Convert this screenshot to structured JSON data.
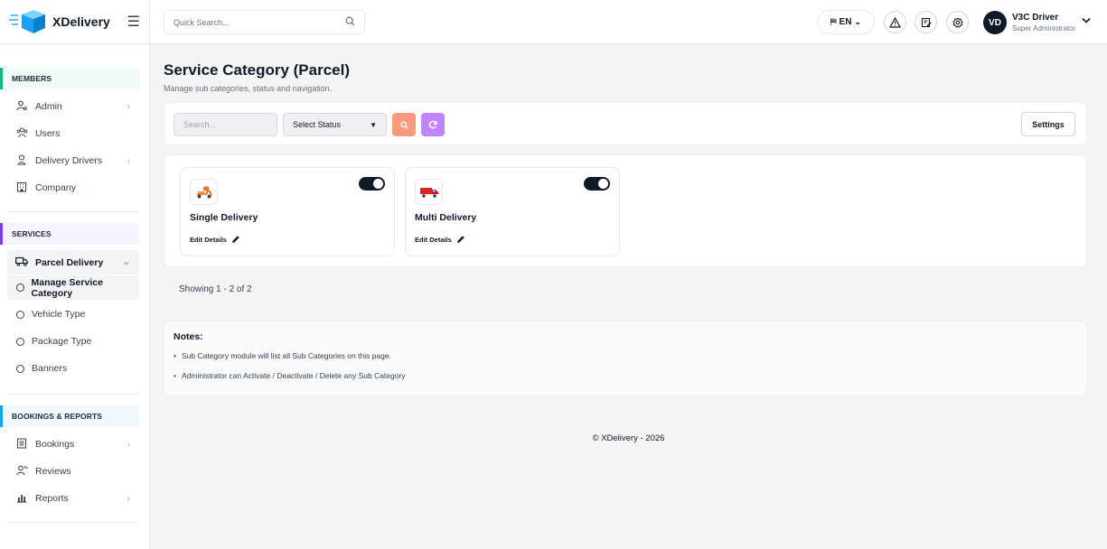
{
  "brand": {
    "name": "XDelivery"
  },
  "topbar": {
    "search_placeholder": "Quick Search...",
    "language": "EN",
    "user": {
      "initials": "VD",
      "name": "V3C Driver",
      "role": "Super Administrator"
    }
  },
  "sidebar": {
    "members": {
      "heading": "MEMBERS",
      "items": [
        {
          "label": "Admin",
          "icon": "user-cog-icon"
        },
        {
          "label": "Users",
          "icon": "users-icon"
        },
        {
          "label": "Delivery Drivers",
          "icon": "driver-icon"
        },
        {
          "label": "Company",
          "icon": "building-icon"
        }
      ]
    },
    "services": {
      "heading": "SERVICES",
      "parent": "Parcel Delivery",
      "sub_items": [
        "Manage Service Category",
        "Vehicle Type",
        "Package Type",
        "Banners"
      ]
    },
    "bookings": {
      "heading": "BOOKINGS & REPORTS",
      "items": [
        {
          "label": "Bookings",
          "icon": "list-icon"
        },
        {
          "label": "Reviews",
          "icon": "review-icon"
        },
        {
          "label": "Reports",
          "icon": "chart-icon"
        }
      ]
    }
  },
  "page": {
    "title": "Service Category (Parcel)",
    "subtitle": "Manage sub categories, status and navigation."
  },
  "filters": {
    "search_placeholder": "Search...",
    "status_select": "Select Status",
    "settings_label": "Settings"
  },
  "categories": [
    {
      "name": "Single Delivery",
      "edit_label": "Edit Details",
      "active": true
    },
    {
      "name": "Multi Delivery",
      "edit_label": "Edit Details",
      "active": true
    }
  ],
  "pagination": {
    "showing": "Showing 1 - 2 of 2"
  },
  "notes": {
    "title": "Notes:",
    "items": [
      "Sub Category module will list all Sub Categories on this page.",
      "Administrator can Activate / Deactivate / Delete any Sub Category"
    ]
  },
  "footer": {
    "text": "© XDelivery - 2026"
  },
  "colors": {
    "accent": "#1da1f2",
    "search_btn": "#fb9a7d",
    "reset_btn": "#c084fc",
    "dark": "#111827"
  }
}
